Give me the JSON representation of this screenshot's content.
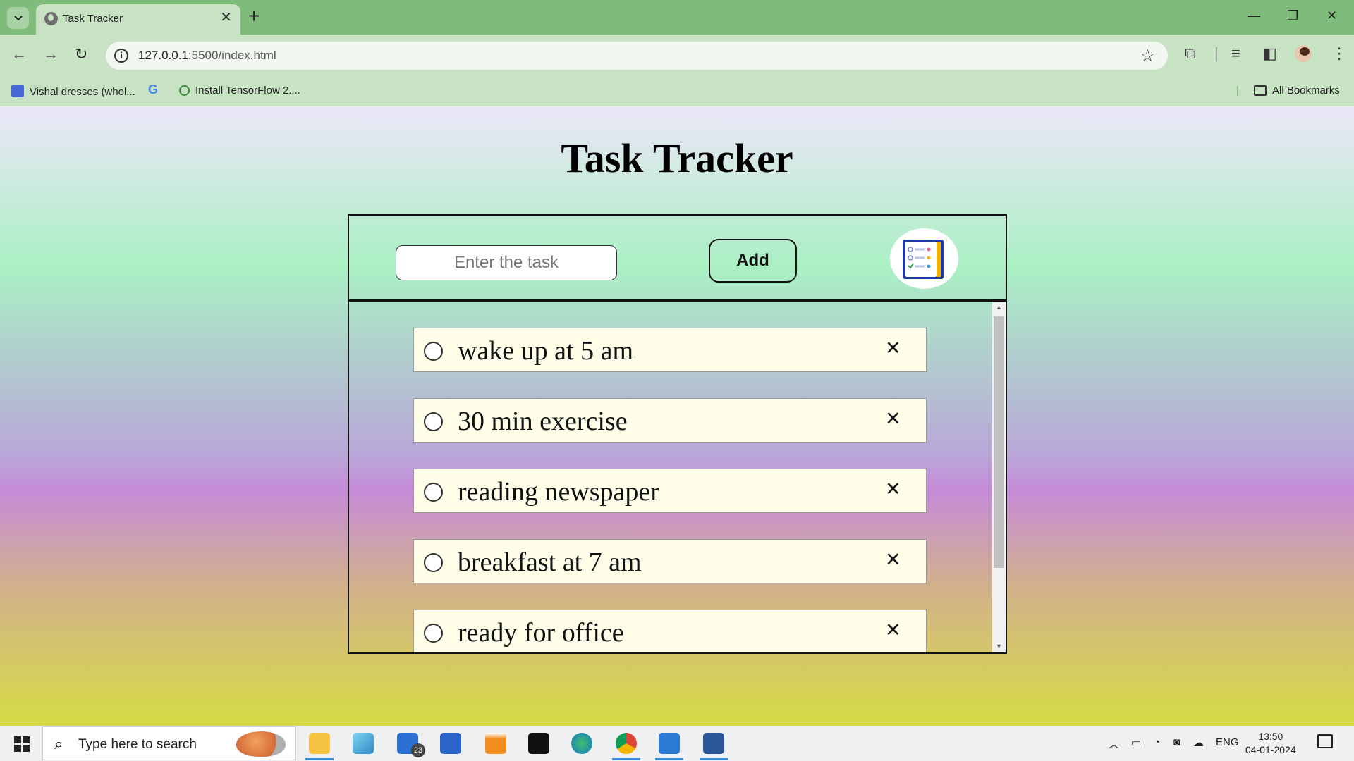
{
  "browser": {
    "tab_title": "Task Tracker",
    "url_host": "127.0.0.1",
    "url_path": ":5500/index.html",
    "bookmarks": [
      {
        "label": "Vishal dresses (whol..."
      },
      {
        "label": ""
      },
      {
        "label": "Install TensorFlow 2...."
      }
    ],
    "all_bookmarks": "All Bookmarks"
  },
  "app": {
    "title": "Task Tracker",
    "input_placeholder": "Enter the task",
    "add_label": "Add",
    "tasks": [
      {
        "text": "wake up at 5 am",
        "done": false
      },
      {
        "text": "30 min exercise",
        "done": false
      },
      {
        "text": "reading newspaper",
        "done": false
      },
      {
        "text": "breakfast at 7 am",
        "done": false
      },
      {
        "text": "ready for office",
        "done": false
      }
    ],
    "delete_glyph": "✕"
  },
  "taskbar": {
    "search_placeholder": "Type here to search",
    "mail_badge": "23",
    "language": "ENG",
    "time": "13:50",
    "date": "04-01-2024"
  },
  "colors": {
    "chrome_tabbar": "#7fbc7b",
    "chrome_toolbar": "#c8e3c4",
    "task_bg": "#fefee9"
  }
}
